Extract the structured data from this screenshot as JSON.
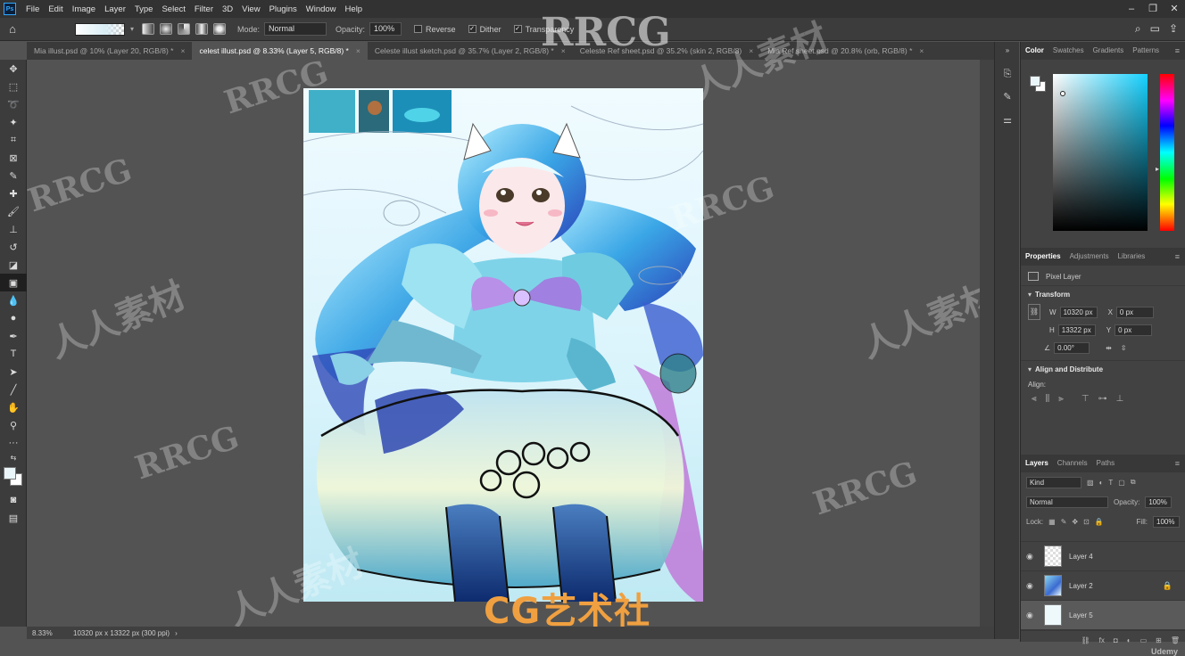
{
  "menubar": {
    "app_icon": "Ps",
    "items": [
      "File",
      "Edit",
      "Image",
      "Layer",
      "Type",
      "Select",
      "Filter",
      "3D",
      "View",
      "Plugins",
      "Window",
      "Help"
    ]
  },
  "options": {
    "mode_label": "Mode:",
    "mode_value": "Normal",
    "opacity_label": "Opacity:",
    "opacity_value": "100%",
    "reverse_label": "Reverse",
    "dither_label": "Dither",
    "transparency_label": "Transparency"
  },
  "tabs": [
    {
      "label": "Mia illust.psd @ 10% (Layer 20, RGB/8) *"
    },
    {
      "label": "celest illust.psd @ 8.33% (Layer 5, RGB/8) *"
    },
    {
      "label": "Celeste illust sketch.psd @ 35.7% (Layer 2, RGB/8) *"
    },
    {
      "label": "Celeste Ref sheet.psd @ 35.2% (skin 2, RGB/8)"
    },
    {
      "label": "Mia Ref sheet.psd @ 20.8% (orb, RGB/8) *"
    }
  ],
  "status": {
    "zoom": "8.33%",
    "doc_info": "10320 px x 13322 px (300 ppi)"
  },
  "color_panel": {
    "tabs": [
      "Color",
      "Swatches",
      "Gradients",
      "Patterns"
    ]
  },
  "properties_panel": {
    "tabs": [
      "Properties",
      "Adjustments",
      "Libraries"
    ],
    "layer_type": "Pixel Layer",
    "transform_title": "Transform",
    "w_label": "W",
    "w_value": "10320 px",
    "h_label": "H",
    "h_value": "13322 px",
    "x_label": "X",
    "x_value": "0 px",
    "y_label": "Y",
    "y_value": "0 px",
    "angle_value": "0.00°",
    "align_title": "Align and Distribute",
    "align_label": "Align:"
  },
  "layers_panel": {
    "tabs": [
      "Layers",
      "Channels",
      "Paths"
    ],
    "filter_kind": "Kind",
    "blend_mode": "Normal",
    "opacity_label": "Opacity:",
    "opacity_value": "100%",
    "lock_label": "Lock:",
    "fill_label": "Fill:",
    "fill_value": "100%",
    "layers": [
      {
        "name": "Layer 4"
      },
      {
        "name": "Layer 2"
      },
      {
        "name": "Layer 5"
      }
    ]
  },
  "watermarks": {
    "rrcg": "RRCG",
    "cn": "人人素材",
    "udemy": "Udemy",
    "cg_logo": "CG艺术社"
  }
}
